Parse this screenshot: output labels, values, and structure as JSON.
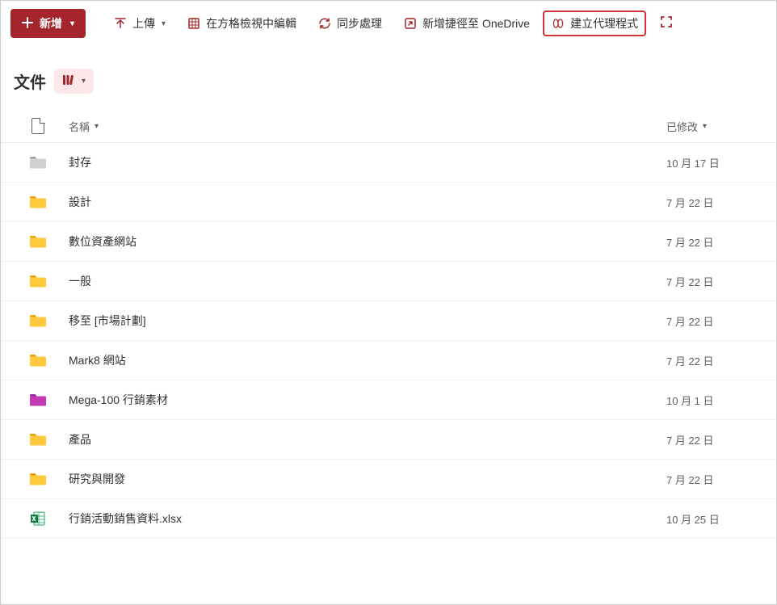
{
  "toolbar": {
    "new_label": "新增",
    "upload_label": "上傳",
    "grid_edit_label": "在方格檢視中編輯",
    "sync_label": "同步處理",
    "shortcut_label": "新增捷徑至 OneDrive",
    "agent_label": "建立代理程式"
  },
  "page": {
    "title": "文件"
  },
  "columns": {
    "name": "名稱",
    "modified": "已修改"
  },
  "files": [
    {
      "name": "封存",
      "modified": "10 月 17 日",
      "icon": "folder-gray"
    },
    {
      "name": "設計",
      "modified": "7 月 22 日",
      "icon": "folder-yellow"
    },
    {
      "name": "數位資產網站",
      "modified": "7 月 22 日",
      "icon": "folder-yellow"
    },
    {
      "name": "一般",
      "modified": "7 月 22 日",
      "icon": "folder-yellow"
    },
    {
      "name": "移至 [市場計劃]",
      "modified": "7 月 22 日",
      "icon": "folder-yellow"
    },
    {
      "name": "Mark8 網站",
      "modified": "7 月 22 日",
      "icon": "folder-yellow"
    },
    {
      "name": "Mega-100 行銷素材",
      "modified": "10 月 1 日",
      "icon": "folder-magenta"
    },
    {
      "name": "產品",
      "modified": "7 月 22 日",
      "icon": "folder-yellow"
    },
    {
      "name": "研究與開發",
      "modified": "7 月 22 日",
      "icon": "folder-yellow"
    },
    {
      "name": "行銷活動銷售資料.xlsx",
      "modified": "10 月 25 日",
      "icon": "excel"
    }
  ]
}
